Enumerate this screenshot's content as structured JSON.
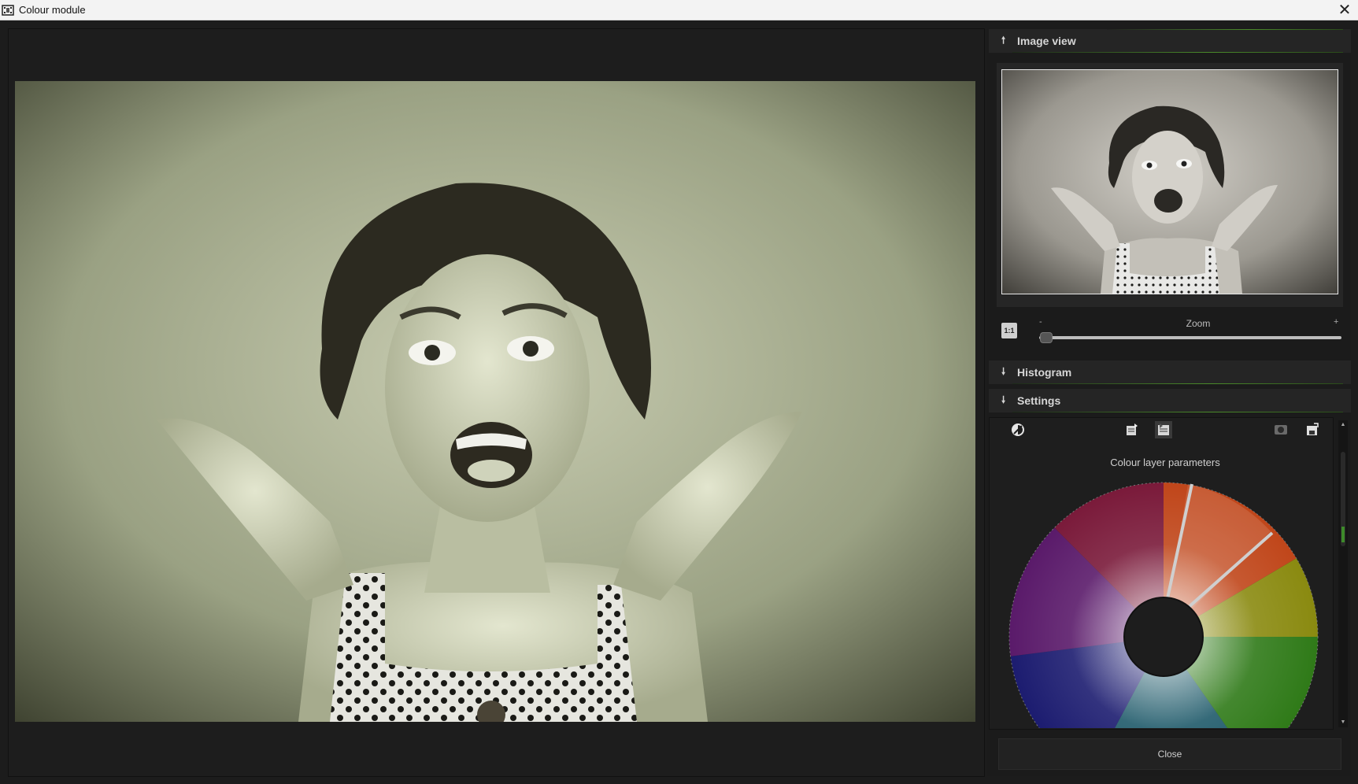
{
  "window": {
    "title": "Colour module",
    "close_icon": "close-icon"
  },
  "panels": {
    "image_view": {
      "label": "Image view",
      "state": "expanded"
    },
    "histogram": {
      "label": "Histogram",
      "state": "collapsed"
    },
    "settings": {
      "label": "Settings",
      "state": "expanded"
    }
  },
  "zoom": {
    "label": "Zoom",
    "minus": "-",
    "plus": "+",
    "one_to_one": "1:1",
    "level": 0.0
  },
  "settings": {
    "layer_title": "Colour layer parameters",
    "toolbar_icons": [
      "contrast-icon",
      "export-preset-icon",
      "import-preset-icon",
      "mask-icon",
      "save-icon"
    ]
  },
  "buttons": {
    "close": "Close"
  },
  "colors": {
    "accent_green": "#4a8a2a",
    "panel_bg": "#1b1b1b",
    "header_bg": "#252525"
  }
}
